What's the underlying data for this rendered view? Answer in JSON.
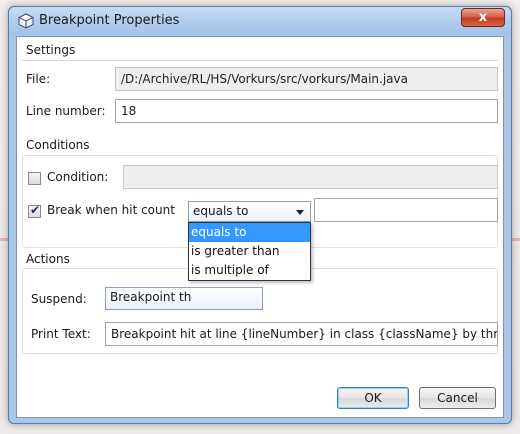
{
  "window": {
    "title": "Breakpoint Properties",
    "close_label": "x"
  },
  "settings": {
    "section_label": "Settings",
    "file_label": "File:",
    "file_value": "/D:/Archive/RL/HS/Vorkurs/src/vorkurs/Main.java",
    "line_number_label": "Line number:",
    "line_number_value": "18"
  },
  "conditions": {
    "section_label": "Conditions",
    "condition_label": "Condition:",
    "condition_checked": false,
    "condition_value": "",
    "hit_count_label": "Break when hit count",
    "hit_count_checked": true,
    "hit_count_mode": "equals to",
    "hit_count_value": "",
    "hit_count_options": [
      "equals to",
      "is greater than",
      "is multiple of"
    ],
    "selected_option_index": 0
  },
  "actions": {
    "section_label": "Actions",
    "suspend_label": "Suspend:",
    "suspend_value": "Breakpoint th",
    "print_text_label": "Print Text:",
    "print_text_value": "Breakpoint hit at line {lineNumber} in class {className} by threa"
  },
  "buttons": {
    "ok_label": "OK",
    "cancel_label": "Cancel"
  },
  "colors": {
    "selection": "#3399ff",
    "titlebar": "#b2cdee",
    "close_button": "#c23a20"
  }
}
